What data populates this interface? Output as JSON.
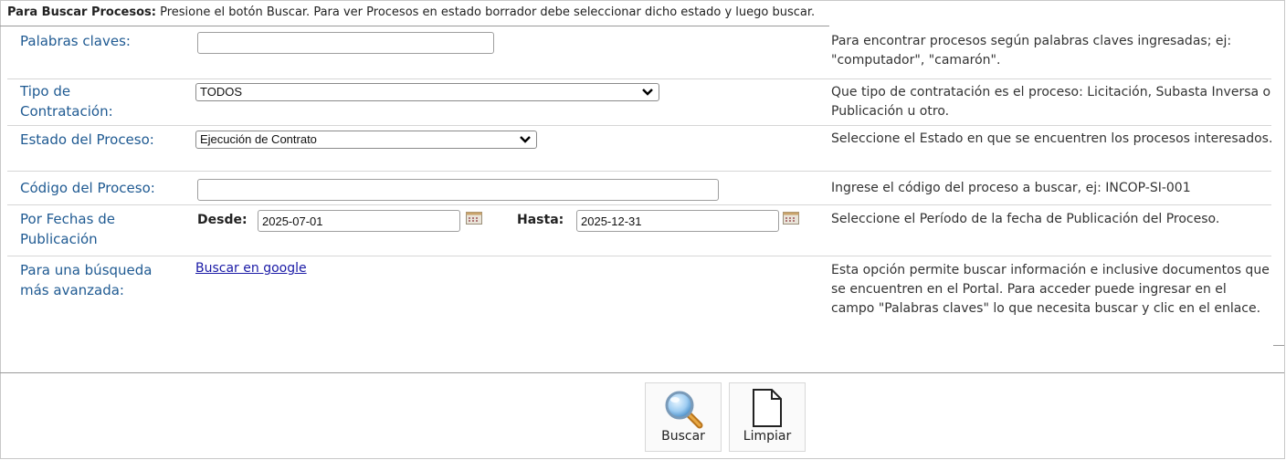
{
  "intro": {
    "bold": "Para Buscar Procesos:",
    "text": " Presione el botón Buscar. Para ver Procesos en estado borrador debe seleccionar dicho estado y luego buscar."
  },
  "keywords": {
    "label": "Palabras claves:",
    "value": "",
    "help": "Para encontrar procesos según palabras claves ingresadas; ej: \"computador\", \"camarón\"."
  },
  "contract_type": {
    "label": "Tipo de Contratación:",
    "selected": "TODOS",
    "help": "Que tipo de contratación es el proceso: Licitación, Subasta Inversa o Publicación u otro."
  },
  "status": {
    "label": "Estado del Proceso:",
    "selected": "Ejecución de Contrato",
    "help": "Seleccione el Estado en que se encuentren los procesos interesados."
  },
  "code": {
    "label": "Código del Proceso:",
    "value": "",
    "help": "Ingrese el código del proceso a buscar, ej: INCOP-SI-001"
  },
  "dates": {
    "label": "Por Fechas de Publicación",
    "from_label": "Desde:",
    "from_value": "2025-07-01",
    "to_label": "Hasta:",
    "to_value": "2025-12-31",
    "help": "Seleccione el Período de la fecha de Publicación del Proceso."
  },
  "advanced": {
    "label": "Para una búsqueda más avanzada:",
    "link": "Buscar en google",
    "help": "Esta opción permite buscar información e inclusive documentos que se encuentren en el Portal. Para acceder puede ingresar en el campo \"Palabras claves\" lo que necesita buscar y clic en el enlace."
  },
  "actions": {
    "search_label": "Buscar",
    "clear_label": "Limpiar"
  },
  "icons": {
    "search": "magnifier-icon",
    "clear": "blank-document-icon",
    "calendar": "calendar-icon",
    "dropdown": "chevron-down-icon"
  }
}
